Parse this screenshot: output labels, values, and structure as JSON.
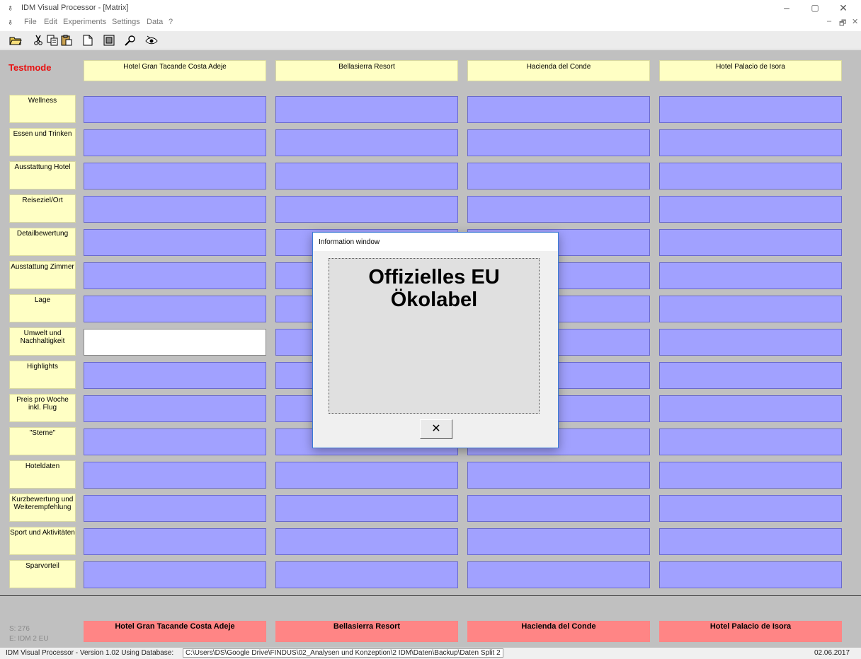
{
  "window": {
    "title": "IDM Visual Processor - [Matrix]",
    "app_icon": "♁",
    "controls": {
      "minimize": "–",
      "maximize": "▢",
      "close": "✕"
    }
  },
  "menu": {
    "items": [
      "File",
      "Edit",
      "Experiments",
      "Settings",
      "Data",
      "?"
    ],
    "mdi_controls": {
      "minimize": "–",
      "restore": "🗗",
      "close": "✕"
    }
  },
  "toolbar": {
    "buttons": [
      "open-folder-icon",
      "cut-icon",
      "copy-icon",
      "paste-icon",
      "new-document-icon",
      "record-icon",
      "search-icon",
      "eye-icon"
    ]
  },
  "matrix": {
    "mode_label": "Testmode",
    "hotels": [
      "Hotel Gran Tacande Costa Adeje",
      "Bellasierra Resort",
      "Hacienda del Conde",
      "Hotel Palacio de Isora"
    ],
    "attributes": [
      "Wellness",
      "Essen und Trinken",
      "Ausstattung Hotel",
      "Reiseziel/Ort",
      "Detailbewertung",
      "Ausstattung Zimmer",
      "Lage",
      "Umwelt und Nachhaltigkeit",
      "Highlights",
      "Preis pro Woche inkl. Flug",
      "\"Sterne\"",
      "Hoteldaten",
      "Kurzbewertung und Weiterempfehlung",
      "Sport und Aktivitäten",
      "Sparvorteil"
    ],
    "opened_cell": {
      "attribute": "Umwelt und Nachhaltigkeit",
      "hotel": "Hotel Gran Tacande Costa Adeje"
    },
    "choice_buttons": [
      "Hotel Gran Tacande Costa Adeje",
      "Bellasierra Resort",
      "Hacienda del Conde",
      "Hotel Palacio de Isora"
    ],
    "stats": {
      "s": "S: 276",
      "e": "E: IDM 2 EU"
    },
    "colors": {
      "cell": "#a1a1ff",
      "label": "#ffffc4",
      "choice": "#ff8585",
      "testmode": "#e81010"
    }
  },
  "dialog": {
    "title": "Information window",
    "message_line1": "Offizielles EU",
    "message_line2": "Ökolabel",
    "close_glyph": "✕"
  },
  "status": {
    "text": "IDM Visual Processor - Version 1.02 Using Database:",
    "path": "C:\\Users\\DS\\Google Drive\\FINDUS\\02_Analysen und Konzeption\\2 IDM\\Daten\\Backup\\Daten Split 2",
    "date": "02.06.2017"
  }
}
